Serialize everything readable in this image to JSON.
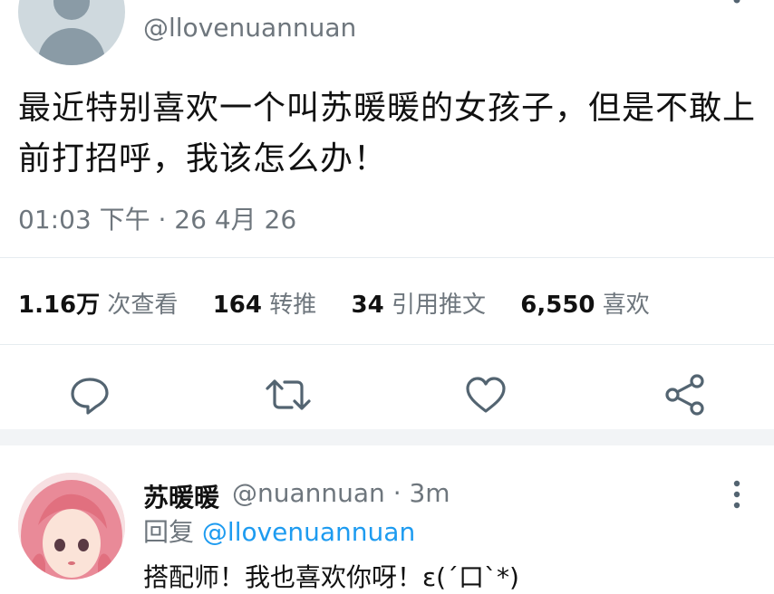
{
  "tweet": {
    "handle": "@llovenuannuan",
    "text": "最近特别喜欢一个叫苏暖暖的女孩子，但是不敢上前打招呼，我该怎么办！",
    "timestamp": "01:03 下午 · 26 4月 26"
  },
  "stats": {
    "views_count": "1.16万",
    "views_label": "次查看",
    "retweets_count": "164",
    "retweets_label": "转推",
    "quotes_count": "34",
    "quotes_label": "引用推文",
    "likes_count": "6,550",
    "likes_label": "喜欢"
  },
  "actions": [
    "reply-icon",
    "retweet-icon",
    "like-icon",
    "share-icon"
  ],
  "reply": {
    "name": "苏暖暖",
    "handle_time": "@nuannuan · 3m",
    "replying_prefix": "回复",
    "replying_to": "@llovenuannuan",
    "text": "搭配师！我也喜欢你呀！ε(´口`*)"
  },
  "colors": {
    "accent": "#1d9bf0",
    "secondary_text": "#6e767d",
    "icon": "#536471"
  }
}
